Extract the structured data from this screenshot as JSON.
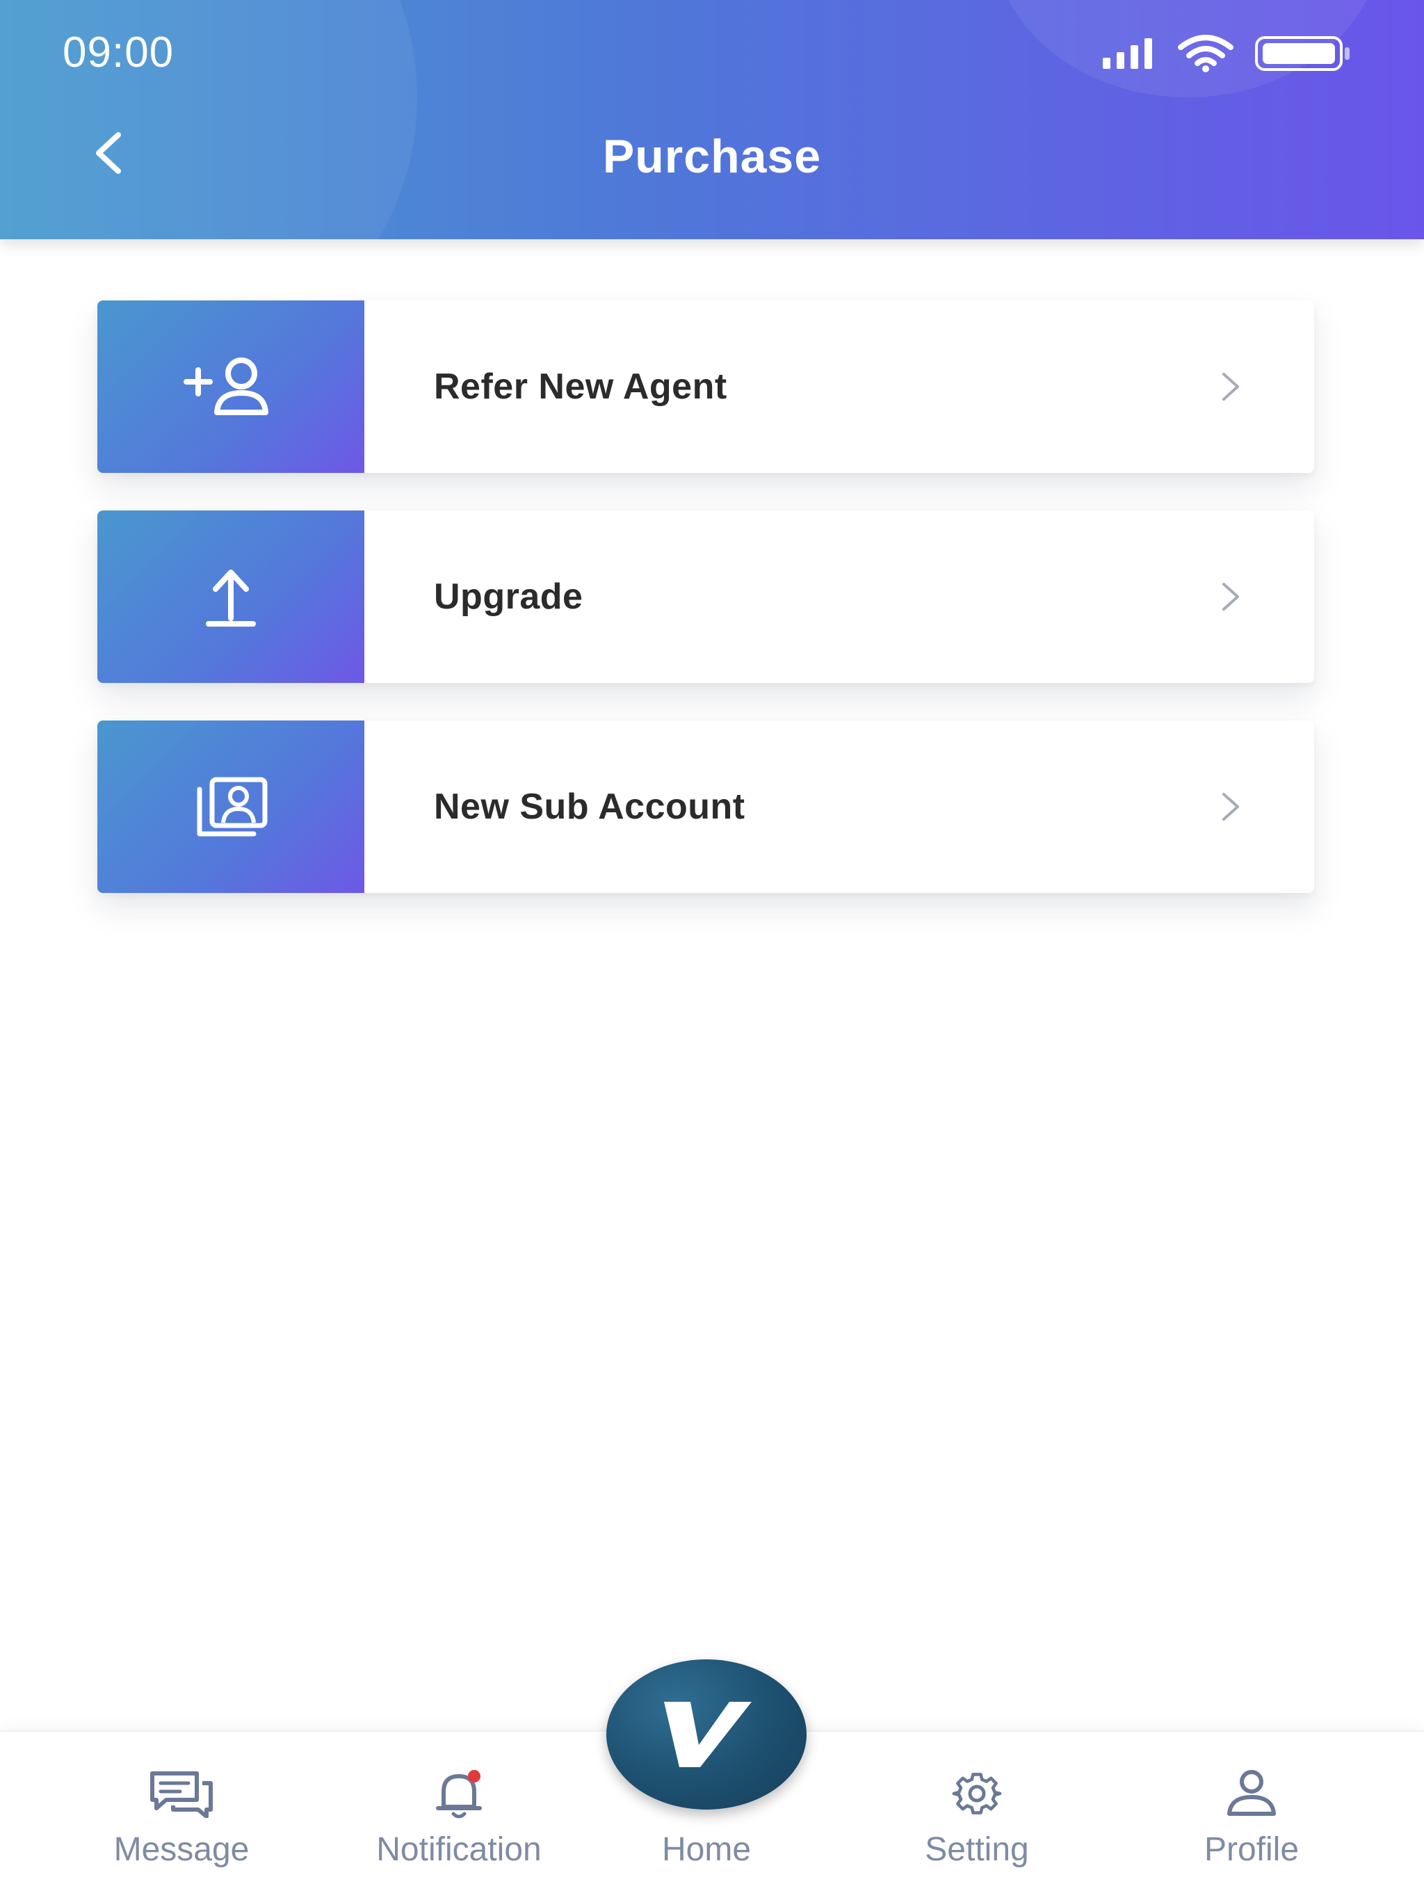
{
  "status_bar": {
    "time": "09:00"
  },
  "header": {
    "title": "Purchase",
    "back_icon": "chevron-left-icon"
  },
  "menu": {
    "items": [
      {
        "label": "Refer New Agent",
        "icon": "add-user-icon"
      },
      {
        "label": "Upgrade",
        "icon": "upload-arrow-icon"
      },
      {
        "label": "New Sub Account",
        "icon": "profile-stack-icon"
      }
    ]
  },
  "bottom_nav": {
    "items": [
      {
        "label": "Message",
        "icon": "chat-bubbles-icon"
      },
      {
        "label": "Notification",
        "icon": "bell-icon",
        "badge": true
      },
      {
        "label": "Home",
        "icon": "home-logo-icon"
      },
      {
        "label": "Setting",
        "icon": "gear-icon"
      },
      {
        "label": "Profile",
        "icon": "person-icon"
      }
    ]
  },
  "colors": {
    "header_gradient_start": "#4a9bd0",
    "header_gradient_end": "#6a55ea",
    "nav_label": "#7f8ba3",
    "badge": "#e23a3a",
    "home_button": "#1d4f6f"
  }
}
